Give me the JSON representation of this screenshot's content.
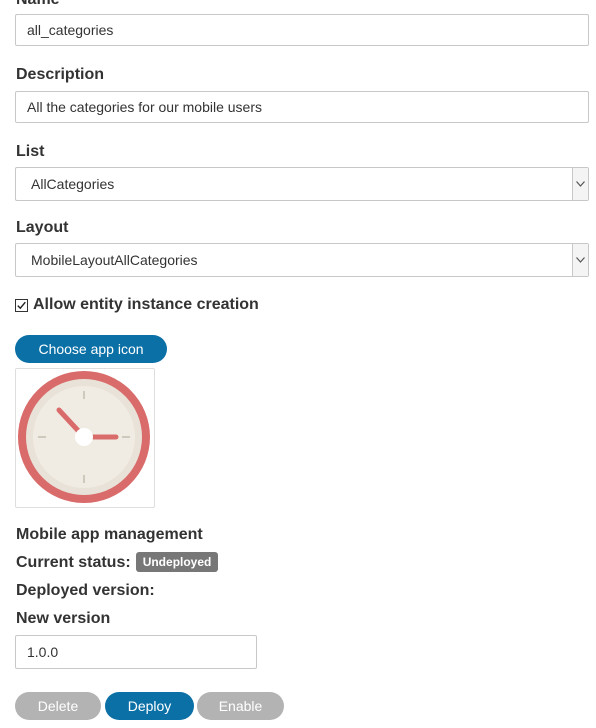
{
  "form": {
    "name_label": "Name",
    "name_value": "all_categories",
    "description_label": "Description",
    "description_value": "All the categories for our mobile users",
    "list_label": "List",
    "list_value": "AllCategories",
    "layout_label": "Layout",
    "layout_value": "MobileLayoutAllCategories",
    "allow_creation_label": "Allow entity instance creation",
    "allow_creation_checked": true,
    "choose_icon_label": "Choose app icon",
    "app_icon": "clock-icon"
  },
  "management": {
    "heading": "Mobile app management",
    "current_status_label": "Current status:",
    "current_status_badge": "Undeployed",
    "deployed_version_label": "Deployed version:",
    "new_version_label": "New version",
    "new_version_value": "1.0.0"
  },
  "actions": {
    "delete_label": "Delete",
    "deploy_label": "Deploy",
    "enable_label": "Enable"
  },
  "colors": {
    "primary": "#0b70a6",
    "disabled": "#b3b3b3",
    "badge": "#777777",
    "clock_rim": "#d96b6b",
    "clock_face": "#f1ece3"
  }
}
